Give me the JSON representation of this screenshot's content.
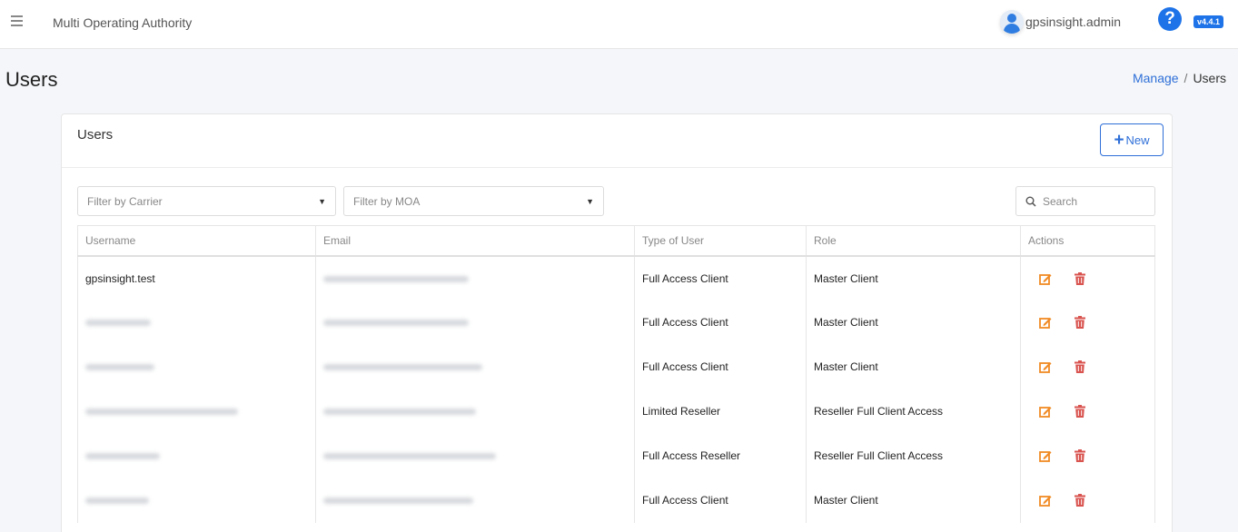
{
  "header": {
    "app_title": "Multi Operating Authority",
    "username": "gpsinsight.admin",
    "version": "v4.4.1",
    "help_icon": "question-circle-icon"
  },
  "page": {
    "title": "Users",
    "breadcrumb": {
      "link": "Manage",
      "separator": "/",
      "current": "Users"
    }
  },
  "card": {
    "title": "Users",
    "new_label": "New"
  },
  "filters": {
    "carrier_placeholder": "Filter by Carrier",
    "moa_placeholder": "Filter by MOA",
    "search_placeholder": "Search"
  },
  "table": {
    "columns": [
      "Username",
      "Email",
      "Type of User",
      "Role",
      "Actions"
    ],
    "rows": [
      {
        "username": "gpsinsight.test",
        "type": "Full Access Client",
        "role": "Master Client"
      },
      {
        "username": "",
        "type": "Full Access Client",
        "role": "Master Client"
      },
      {
        "username": "",
        "type": "Full Access Client",
        "role": "Master Client"
      },
      {
        "username": "",
        "type": "Limited Reseller",
        "role": "Reseller Full Client Access"
      },
      {
        "username": "",
        "type": "Full Access Reseller",
        "role": "Reseller Full Client Access"
      },
      {
        "username": "",
        "type": "Full Access Client",
        "role": "Master Client"
      }
    ]
  },
  "colors": {
    "accent": "#1e73e8",
    "link": "#2e6fd8",
    "edit": "#f08a24",
    "delete": "#d9534f"
  }
}
